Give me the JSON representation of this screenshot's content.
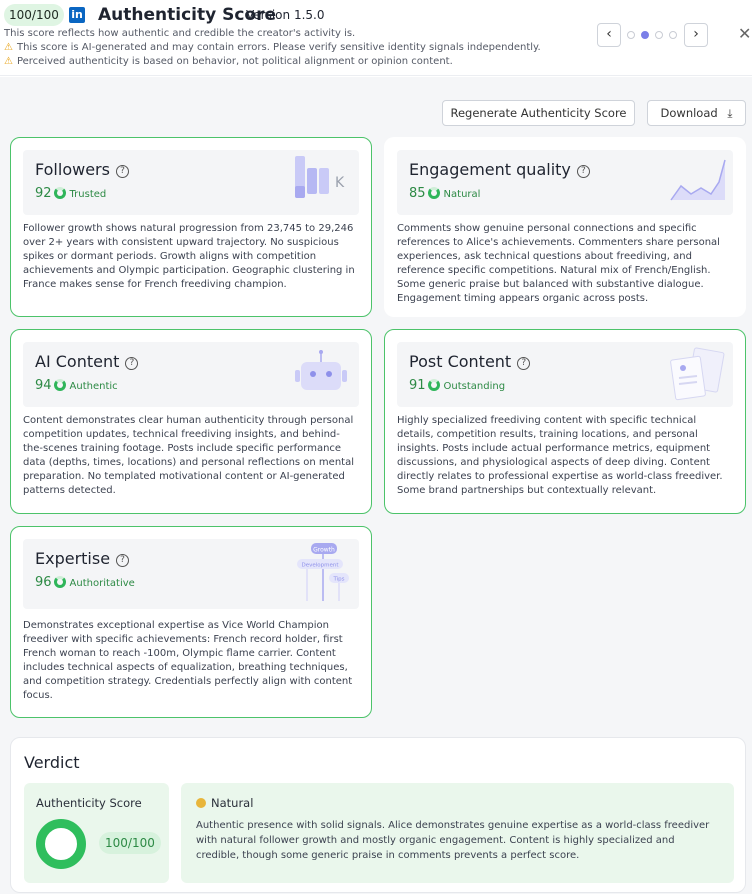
{
  "header": {
    "score_pill": "100/100",
    "linkedin_icon": "in",
    "title": "Authenticity Score",
    "version": "Version 1.5.0",
    "description": "This score reflects how authentic and credible the creator's activity is.",
    "warnings": [
      "This score is AI-generated and may contain errors. Please verify sensitive identity signals independently.",
      "Perceived authenticity is based on behavior, not political alignment or opinion content."
    ],
    "nav_prev": "‹",
    "nav_next": "›",
    "close": "✕",
    "active_page": 2,
    "total_pages": 4
  },
  "actions": {
    "regenerate_label": "Regenerate Authenticity Score",
    "download_label": "Download"
  },
  "cards": {
    "followers": {
      "title": "Followers",
      "score": "92",
      "label": "Trusted",
      "illus_text": "K",
      "body": "Follower growth shows natural progression from 23,745 to 29,246 over 2+ years with consistent upward trajectory. No suspicious spikes or dormant periods. Growth aligns with competition achievements and Olympic participation. Geographic clustering in France makes sense for French freediving champion."
    },
    "engagement": {
      "title": "Engagement quality",
      "score": "85",
      "label": "Natural",
      "body": "Comments show genuine personal connections and specific references to Alice's achievements. Commenters share personal experiences, ask technical questions about freediving, and reference specific competitions. Natural mix of French/English. Some generic praise but balanced with substantive dialogue. Engagement timing appears organic across posts."
    },
    "ai_content": {
      "title": "AI Content",
      "score": "94",
      "label": "Authentic",
      "body": "Content demonstrates clear human authenticity through personal competition updates, technical freediving insights, and behind-the-scenes training footage. Posts include specific performance data (depths, times, locations) and personal reflections on mental preparation. No templated motivational content or AI-generated patterns detected."
    },
    "post_content": {
      "title": "Post Content",
      "score": "91",
      "label": "Outstanding",
      "body": "Highly specialized freediving content with specific technical details, competition results, training locations, and personal insights. Posts include actual performance metrics, equipment discussions, and physiological aspects of deep diving. Content directly relates to professional expertise as world-class freediver. Some brand partnerships but contextually relevant."
    },
    "expertise": {
      "title": "Expertise",
      "score": "96",
      "label": "Authoritative",
      "illus_labels": [
        "Growth",
        "Development",
        "Tips"
      ],
      "body": "Demonstrates exceptional expertise as Vice World Champion freediver with specific achievements: French record holder, first French woman to reach -100m, Olympic flame carrier. Content includes technical aspects of equalization, breathing techniques, and competition strategy. Credentials perfectly align with content focus."
    }
  },
  "verdict": {
    "title": "Verdict",
    "score_title": "Authenticity Score",
    "score_value": "100/100",
    "score_fraction": 1.0,
    "category": "Natural",
    "summary": "Authentic presence with solid signals. Alice demonstrates genuine expertise as a world-class freediver with natural follower growth and mostly organic engagement. Content is highly specialized and credible, though some generic praise in comments prevents a perfect score."
  },
  "colors": {
    "accent_green": "#2fbe5d",
    "card_border_green": "#4cc36a",
    "linkedin_blue": "#0a66c2",
    "pager_active": "#7b7fe8",
    "illus_purple": "#a8a9f0"
  }
}
